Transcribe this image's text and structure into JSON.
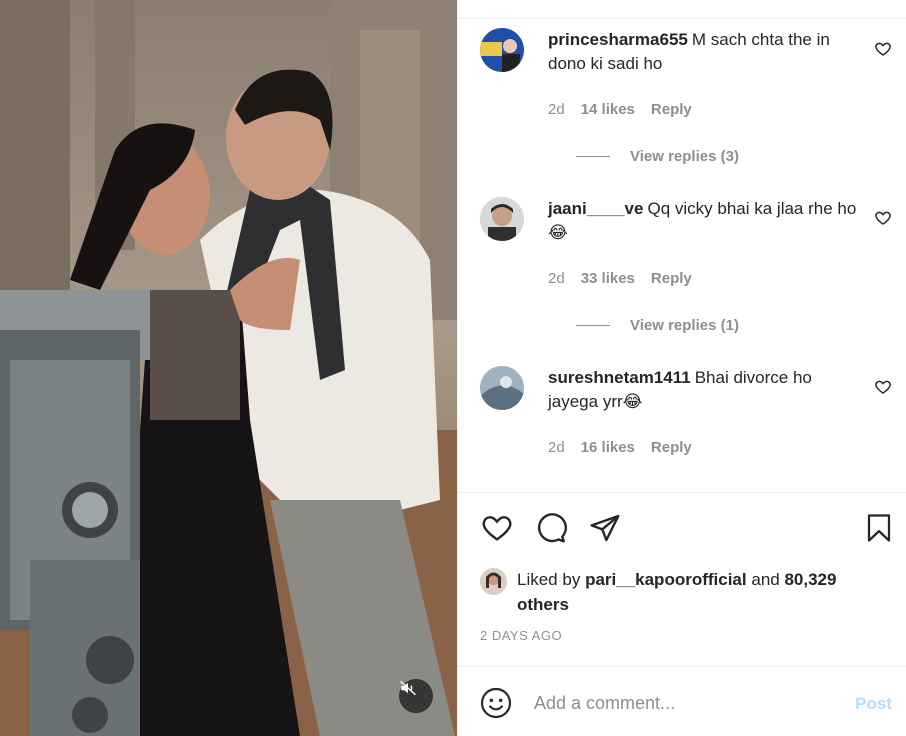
{
  "media": {
    "mute_icon": "speaker-muted-icon"
  },
  "comments": [
    {
      "username": "princesharma655",
      "text": "M sach chta the in dono ki sadi ho",
      "time": "2d",
      "likes": "14 likes",
      "reply": "Reply",
      "view_replies": "View replies (3)",
      "avatar_color": "#1f4fa8"
    },
    {
      "username": "jaani____ve",
      "text": "Qq vicky bhai ka jlaa rhe ho",
      "emoji": "😂",
      "time": "2d",
      "likes": "33 likes",
      "reply": "Reply",
      "view_replies": "View replies (1)",
      "avatar_color": "#3a3a3a"
    },
    {
      "username": "sureshnetam1411",
      "text": "Bhai divorce ho jayega yrr",
      "emoji": "😂",
      "time": "2d",
      "likes": "16 likes",
      "reply": "Reply",
      "avatar_color": "#6f8aa0"
    }
  ],
  "actions": {
    "like_icon": "heart-icon",
    "comment_icon": "comment-icon",
    "share_icon": "paper-plane-icon",
    "save_icon": "bookmark-icon"
  },
  "liked_by": {
    "prefix": "Liked by",
    "user": "pari__kapoorofficial",
    "and": "and",
    "others": "80,329 others"
  },
  "date": "2 DAYS AGO",
  "add_comment": {
    "placeholder": "Add a comment...",
    "post_label": "Post",
    "emoji_icon": "smiley-icon"
  },
  "colors": {
    "text": "#262626",
    "muted": "#8e8e8e",
    "post_disabled": "#b2dffc",
    "divider": "#efefef"
  }
}
